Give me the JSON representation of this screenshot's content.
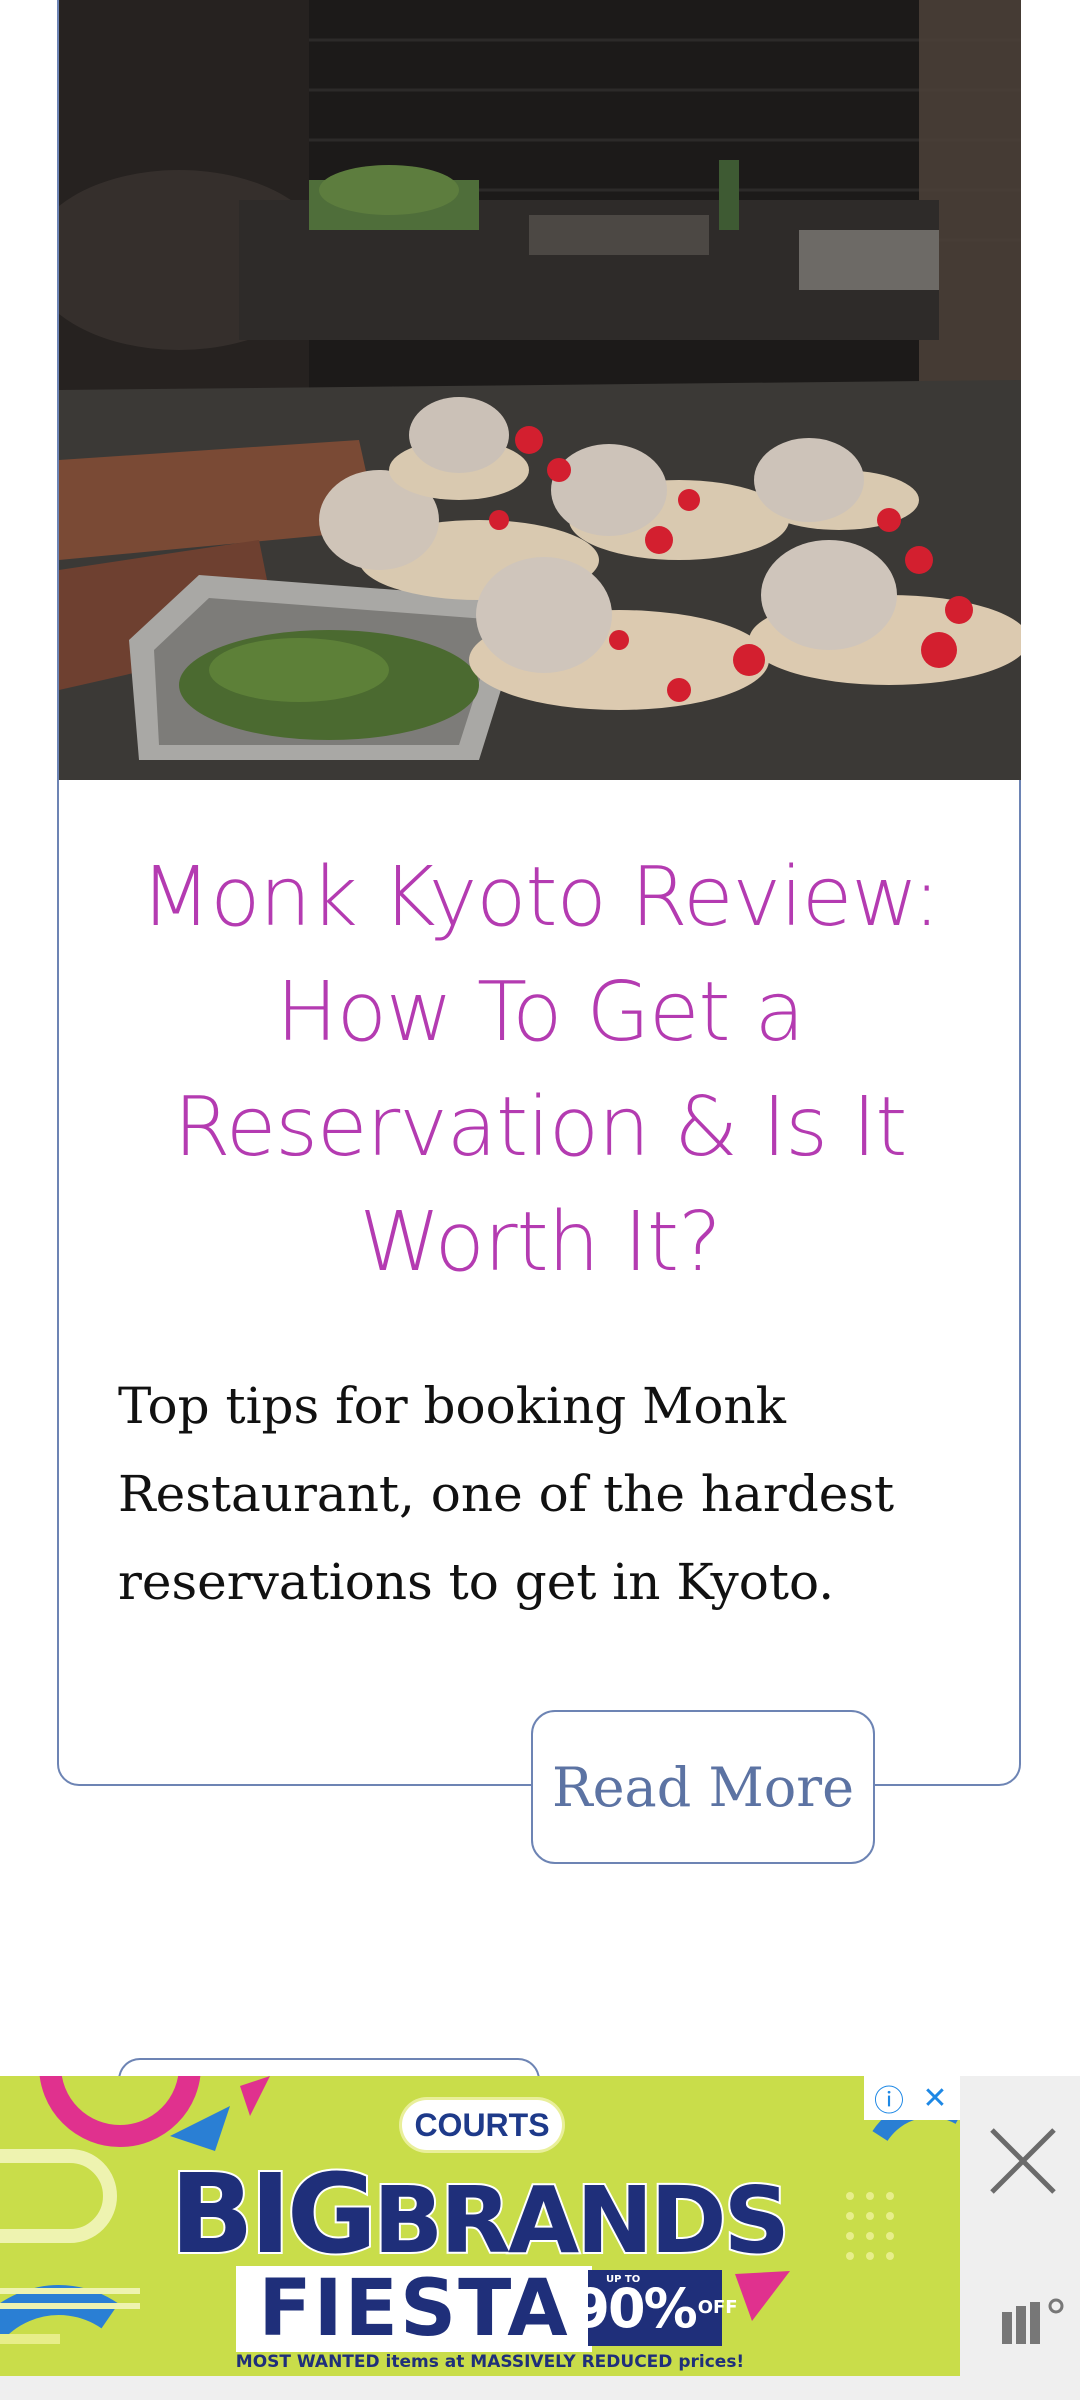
{
  "article": {
    "title": "Monk Kyoto Review: How To Get a Reservation & Is It Worth It?",
    "excerpt": "Top tips for booking Monk Restaurant, one of the hardest reservations to get in Kyoto.",
    "read_more_label": "Read More"
  },
  "ad": {
    "brand": "COURTS",
    "headline_big": "BIG",
    "headline_brands": "BRANDS",
    "headline_fiesta": "FIESTA",
    "discount_upto": "UP TO",
    "discount_value": "90%",
    "discount_off": "OFF",
    "footer": "MOST WANTED items at MASSIVELY REDUCED prices!",
    "info_icon": "info-icon",
    "close_icon": "close-icon",
    "colors": {
      "background": "#c9dd4a",
      "navy": "#1f2f7a",
      "pink": "#e0318e",
      "blue": "#2a7fd4"
    }
  },
  "theme": {
    "accent": "#b43bb1",
    "border": "#6d84b4"
  }
}
